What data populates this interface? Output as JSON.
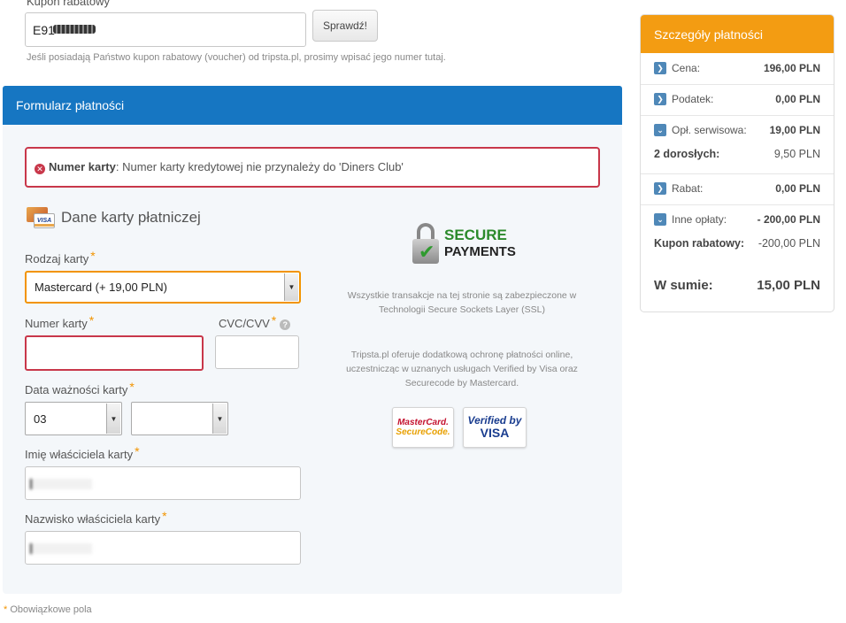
{
  "coupon": {
    "label": "Kupon rabatowy",
    "value": "E91",
    "check_label": "Sprawdź!",
    "hint": "Jeśli posiadają Państwo kupon rabatowy (voucher) od tripsta.pl, prosimy wpisać jego numer tutaj."
  },
  "form": {
    "header": "Formularz płatności",
    "error_field": "Numer karty",
    "error_text": ": Numer karty kredytowej nie przynależy do 'Diners Club'",
    "section_title": "Dane karty płatniczej",
    "card_type_label": "Rodzaj karty",
    "card_type_value": "Mastercard (+ 19,00 PLN)",
    "card_number_label": "Numer karty",
    "cvc_label": "CVC/CVV",
    "expiry_label": "Data ważności karty",
    "expiry_month": "03",
    "expiry_year": "",
    "first_name_label": "Imię właściciela karty",
    "last_name_label": "Nazwisko właściciela karty",
    "required_star": "*",
    "visa_mini": "VISA"
  },
  "secure": {
    "line1": "SECURE",
    "line2": "PAYMENTS",
    "desc1": "Wszystkie transakcje na tej stronie są zabezpieczone w Technologii Secure Sockets Layer (SSL)",
    "desc2": "Tripsta.pl oferuje dodatkową ochronę płatności online, uczestnicząc w uznanych usługach Verified by Visa oraz Securecode by Mastercard.",
    "mc_line1": "MasterCard.",
    "mc_line2": "SecureCode.",
    "visa_line1": "Verified by",
    "visa_line2": "VISA"
  },
  "summary": {
    "header": "Szczegóły płatności",
    "rows": [
      {
        "label": "Cena:",
        "value": "196,00 PLN",
        "icon": "chevron-right"
      },
      {
        "label": "Podatek:",
        "value": "0,00 PLN",
        "icon": "chevron-right"
      },
      {
        "label": "Opł. serwisowa:",
        "value": "19,00 PLN",
        "icon": "chevron-down"
      },
      {
        "label": "Rabat:",
        "value": "0,00 PLN",
        "icon": "chevron-right"
      },
      {
        "label": "Inne opłaty:",
        "value": "- 200,00 PLN",
        "icon": "chevron-down"
      }
    ],
    "sub_adults_label": "2 dorosłych:",
    "sub_adults_value": "9,50 PLN",
    "sub_coupon_label": "Kupon rabatowy:",
    "sub_coupon_value": "-200,00 PLN",
    "total_label": "W sumie:",
    "total_value": "15,00 PLN"
  },
  "footer": {
    "star": "*",
    "note": " Obowiązkowe pola"
  },
  "colors": {
    "header_blue": "#1676c2",
    "summary_orange": "#f39c12",
    "error_red": "#c8374a",
    "required_orange": "#f29400"
  }
}
